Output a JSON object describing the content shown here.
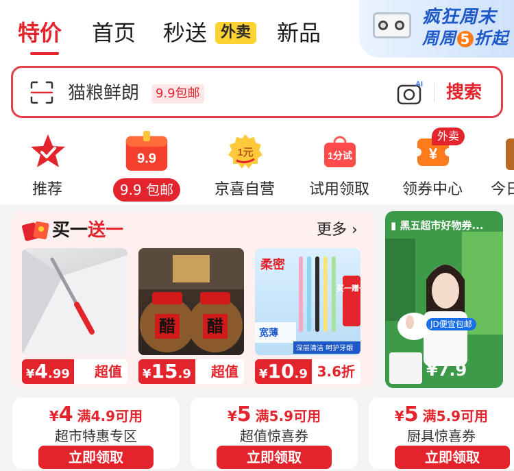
{
  "top_tabs": [
    {
      "label": "特价",
      "active": true
    },
    {
      "label": "首页"
    },
    {
      "label": "秒送"
    },
    {
      "label": "新品"
    }
  ],
  "waimai_tag": "外卖",
  "promo": {
    "line1": "疯狂周末",
    "line2_a": "周周",
    "line2_num": "5",
    "line2_b": "折起"
  },
  "search": {
    "value": "猫粮鲜朗",
    "badge": "9.9包邮",
    "ai_label": "AI",
    "button": "搜索"
  },
  "categories": [
    {
      "label": "推荐",
      "icon": "star-check-icon"
    },
    {
      "label": "9.9 包邮",
      "icon_text": "9.9",
      "active": true
    },
    {
      "label": "京喜自营",
      "icon_text": "1元"
    },
    {
      "label": "试用领取",
      "icon_text": "1分试"
    },
    {
      "label": "领券中心",
      "icon_text": "¥",
      "badge": "外卖"
    },
    {
      "label": "今日"
    }
  ],
  "bogo": {
    "title_a": "买一",
    "title_b": "送一",
    "more": "更多",
    "products": [
      {
        "yen": "¥",
        "int": "4",
        "dec": ".99",
        "tag": "超值",
        "alt": "screwdriver"
      },
      {
        "yen": "¥",
        "int": "15",
        "dec": ".9",
        "tag": "超值",
        "alt": "vinegar jars",
        "jar_text": "醋"
      },
      {
        "yen": "¥",
        "int": "10",
        "dec": ".9",
        "tag": "3.6折",
        "alt": "toothbrushes",
        "img_text1": "柔密",
        "img_text2": "买一赠一",
        "img_text3": "宽薄",
        "img_text4": "深层清洁 呵护牙龈"
      }
    ]
  },
  "video": {
    "title": "黑五超市好物券...",
    "price": "¥7.9",
    "banner": "JD便宜包邮"
  },
  "coupons": [
    {
      "yen": "¥",
      "num": "4",
      "cond": "满4.9可用",
      "name": "超市特惠专区",
      "button": "立即领取"
    },
    {
      "yen": "¥",
      "num": "5",
      "cond": "满5.9可用",
      "name": "超值惊喜券",
      "button": "立即领取"
    },
    {
      "yen": "¥",
      "num": "5",
      "cond": "满5.9可用",
      "name": "厨具惊喜券",
      "button": "立即领取"
    }
  ],
  "colors": {
    "brand_red": "#e4242d",
    "waimai_yellow": "#ffd233",
    "promo_blue": "#1d58c8"
  }
}
